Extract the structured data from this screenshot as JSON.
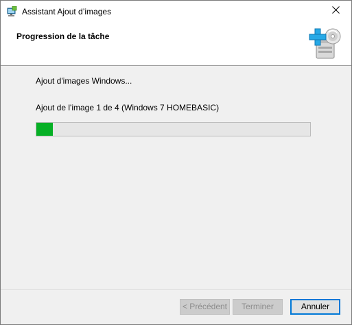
{
  "window": {
    "title": "Assistant Ajout d’images"
  },
  "header": {
    "title": "Progression de la tâche"
  },
  "content": {
    "status": "Ajout d'images Windows...",
    "detail": "Ajout de l'image 1 de 4 (Windows 7 HOMEBASIC)",
    "progress_fraction": 0.06
  },
  "footer": {
    "previous_label": "< Précédent",
    "finish_label": "Terminer",
    "cancel_label": "Annuler"
  },
  "colors": {
    "progress_fill": "#06b025",
    "focus_border": "#0078d7"
  },
  "icons": {
    "title_icon": "wds-add-image-icon",
    "header_icon": "add-disk-image-icon",
    "close_icon": "close-icon"
  }
}
